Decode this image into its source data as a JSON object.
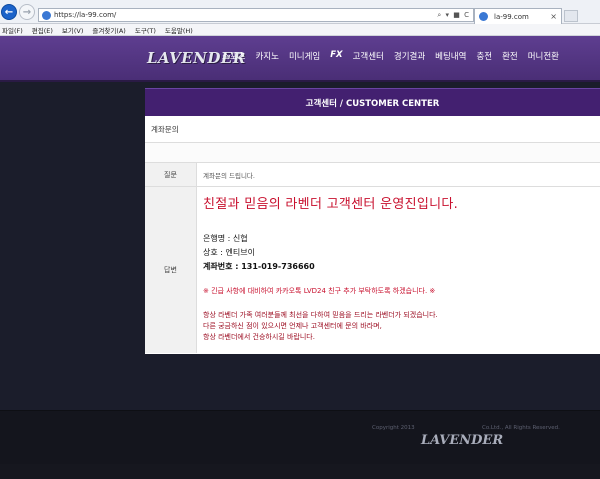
{
  "browser": {
    "url": "https://la-99.com/",
    "address_icons": "⌕ ▾ ■ C",
    "tab_title": "la-99.com",
    "tab_close": "×",
    "menu": [
      "파일(F)",
      "편집(E)",
      "보기(V)",
      "즐겨찾기(A)",
      "도구(T)",
      "도움말(H)"
    ]
  },
  "site": {
    "logo": "LAVENDER",
    "nav": [
      "스포츠",
      "카지노",
      "미니게임",
      "FX",
      "고객센터",
      "경기결과",
      "베팅내역",
      "충전",
      "환전",
      "머니전환"
    ]
  },
  "customer_center": {
    "title": "고객센터 / CUSTOMER CENTER",
    "heading": "계좌문의",
    "question_label": "질문",
    "question_text": "계좌문의 드립니다.",
    "answer_label": "답변",
    "answer": {
      "heading": "친절과 믿음의 라벤더 고객센터 운영진입니다.",
      "bank": "은행명 : 신협",
      "company": "상호 : 엔티브이",
      "account": "계좌번호 : 131-019-736660",
      "notice": "※ 긴급 사항에 대비하여 카카오톡 LVD24 친구 추가 부탁하도록 하겠습니다. ※",
      "thanks_1": "항상 라벤더 가족 여러분들께 최선을 다하여 믿음을 드리는 라벤더가 되겠습니다.",
      "thanks_2": "다른 궁금하신 점이 있으시면 언제나 고객센터에 문의 바라며,",
      "thanks_3": "항상 라벤더에서 건승하시길 바랍니다."
    }
  },
  "footer": {
    "copyright": "Copyright 2013",
    "rights": "Co.Ltd., All Rights Reserved.",
    "logo": "LAVENDER"
  },
  "colors": {
    "header": "#4a2e76",
    "title_bar": "#432070",
    "accent_red": "#c8102e",
    "background": "#1b1d2b"
  }
}
